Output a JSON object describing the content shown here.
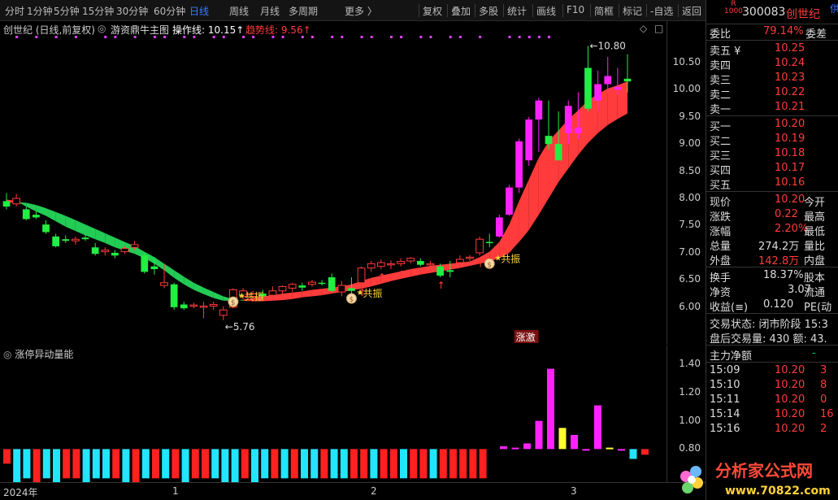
{
  "toolbar": {
    "tabs": [
      "分时",
      "1分钟",
      "5分钟",
      "15分钟",
      "30分钟",
      "60分钟",
      "日线",
      "周线",
      "月线",
      "多周期",
      "更多 〉"
    ],
    "active_tab": "日线",
    "tools": [
      "复权",
      "叠加",
      "多股",
      "统计",
      "画线",
      "F10",
      "简框",
      "标记",
      "-自选",
      "返回"
    ]
  },
  "info": {
    "stock_label": "创世纪 (日线,前复权)",
    "indicator_name": "游资鼎牛主图",
    "op_line_label": "操作线: 10.15↑",
    "trend_line_label": "趋势线: 9.56↑",
    "diamond": "◇",
    "square": "□"
  },
  "chart_annotations": {
    "high_label": "10.80",
    "low_label": "5.76",
    "gongzhen": "共振",
    "zhangji": "涨激"
  },
  "vol_panel": {
    "title": "涨停异动量能"
  },
  "date_axis": [
    "2024年",
    "1",
    "2",
    "3"
  ],
  "chart_data": [
    {
      "type": "candlestick",
      "title": "创世纪 (日线,前复权)",
      "ylim": [
        5.4,
        10.9
      ],
      "yticks": [
        6.0,
        6.5,
        7.0,
        7.5,
        8.0,
        8.5,
        9.0,
        9.5,
        10.0,
        10.5
      ],
      "candles": [
        [
          7.95,
          8.1,
          7.8,
          7.85
        ],
        [
          7.9,
          8.08,
          7.85,
          8.0
        ],
        [
          7.8,
          7.85,
          7.6,
          7.62
        ],
        [
          7.7,
          7.78,
          7.62,
          7.65
        ],
        [
          7.52,
          7.6,
          7.35,
          7.38
        ],
        [
          7.3,
          7.35,
          7.1,
          7.12
        ],
        [
          7.25,
          7.32,
          7.18,
          7.22
        ],
        [
          7.22,
          7.3,
          7.15,
          7.25
        ],
        [
          7.28,
          7.35,
          7.22,
          7.25
        ],
        [
          7.1,
          7.18,
          6.95,
          6.98
        ],
        [
          7.02,
          7.1,
          6.95,
          7.05
        ],
        [
          7.0,
          7.05,
          6.9,
          6.95
        ],
        [
          7.02,
          7.12,
          6.98,
          7.08
        ],
        [
          7.1,
          7.22,
          7.05,
          7.15
        ],
        [
          6.95,
          7.0,
          6.62,
          6.65
        ],
        [
          6.75,
          6.92,
          6.6,
          6.7
        ],
        [
          6.4,
          6.8,
          6.35,
          6.45
        ],
        [
          6.42,
          6.45,
          5.95,
          6.0
        ],
        [
          6.05,
          6.1,
          5.95,
          5.98
        ],
        [
          6.02,
          6.08,
          5.98,
          6.04
        ],
        [
          6.0,
          6.1,
          5.8,
          6.02
        ],
        [
          6.02,
          6.1,
          5.95,
          6.05
        ],
        [
          5.85,
          6.02,
          5.76,
          5.95
        ],
        [
          6.0,
          6.35,
          5.98,
          6.32
        ],
        [
          6.2,
          6.35,
          6.15,
          6.3
        ],
        [
          6.2,
          6.3,
          6.1,
          6.25
        ],
        [
          6.25,
          6.32,
          6.15,
          6.2
        ],
        [
          6.22,
          6.38,
          6.18,
          6.3
        ],
        [
          6.3,
          6.4,
          6.25,
          6.38
        ],
        [
          6.35,
          6.45,
          6.28,
          6.42
        ],
        [
          6.4,
          6.45,
          6.3,
          6.36
        ],
        [
          6.42,
          6.5,
          6.38,
          6.46
        ],
        [
          6.45,
          6.5,
          6.4,
          6.44
        ],
        [
          6.55,
          6.62,
          6.28,
          6.3
        ],
        [
          6.28,
          6.48,
          6.2,
          6.4
        ],
        [
          6.35,
          6.55,
          6.2,
          6.3
        ],
        [
          6.45,
          6.75,
          6.42,
          6.72
        ],
        [
          6.72,
          6.85,
          6.65,
          6.8
        ],
        [
          6.75,
          6.88,
          6.7,
          6.82
        ],
        [
          6.78,
          6.86,
          6.7,
          6.8
        ],
        [
          6.8,
          6.9,
          6.75,
          6.84
        ],
        [
          6.85,
          6.92,
          6.8,
          6.9
        ],
        [
          6.85,
          6.9,
          6.75,
          6.78
        ],
        [
          6.8,
          6.85,
          6.75,
          6.8
        ],
        [
          6.75,
          6.8,
          6.55,
          6.58
        ],
        [
          6.68,
          6.85,
          6.55,
          6.65
        ],
        [
          6.82,
          6.95,
          6.8,
          6.88
        ],
        [
          6.9,
          6.96,
          6.85,
          6.92
        ],
        [
          7.0,
          7.3,
          6.95,
          7.25
        ],
        [
          7.2,
          7.35,
          7.1,
          7.18
        ],
        [
          7.3,
          7.7,
          7.28,
          7.65
        ],
        [
          7.7,
          8.25,
          7.68,
          8.2
        ],
        [
          8.2,
          9.1,
          8.1,
          9.05
        ],
        [
          8.7,
          9.5,
          8.6,
          9.45
        ],
        [
          9.45,
          9.85,
          8.85,
          9.8
        ],
        [
          9.15,
          9.8,
          8.9,
          9.0
        ],
        [
          9.0,
          9.6,
          8.85,
          8.7
        ],
        [
          9.2,
          9.8,
          9.0,
          9.7
        ],
        [
          9.2,
          9.95,
          9.1,
          9.3
        ],
        [
          10.4,
          10.8,
          9.6,
          9.65
        ],
        [
          9.8,
          10.35,
          9.6,
          10.1
        ],
        [
          10.1,
          10.6,
          9.95,
          10.25
        ],
        [
          10.0,
          10.4,
          9.9,
          10.05
        ],
        [
          10.2,
          10.65,
          9.95,
          10.15
        ]
      ],
      "op_line": [
        7.98,
        7.95,
        7.85,
        7.76,
        7.68,
        7.58,
        7.48,
        7.4,
        7.32,
        7.25,
        7.18,
        7.1,
        7.04,
        6.98,
        6.9,
        6.8,
        6.68,
        6.54,
        6.42,
        6.32,
        6.24,
        6.17,
        6.12,
        6.12,
        6.14,
        6.17,
        6.2,
        6.22,
        6.25,
        6.27,
        6.29,
        6.32,
        6.34,
        6.36,
        6.38,
        6.42,
        6.48,
        6.54,
        6.58,
        6.62,
        6.66,
        6.7,
        6.73,
        6.76,
        6.78,
        6.8,
        6.82,
        6.84,
        6.92,
        7.02,
        7.2,
        7.52,
        7.95,
        8.35,
        8.75,
        9.05,
        9.25,
        9.45,
        9.62,
        9.8,
        9.92,
        10.02,
        10.08,
        10.15
      ],
      "trend_line": [
        7.92,
        7.93,
        7.92,
        7.88,
        7.82,
        7.75,
        7.68,
        7.6,
        7.52,
        7.44,
        7.36,
        7.28,
        7.2,
        7.12,
        7.02,
        6.92,
        6.8,
        6.68,
        6.56,
        6.45,
        6.36,
        6.28,
        6.2,
        6.15,
        6.12,
        6.11,
        6.11,
        6.12,
        6.13,
        6.15,
        6.18,
        6.2,
        6.22,
        6.25,
        6.28,
        6.31,
        6.34,
        6.38,
        6.43,
        6.48,
        6.52,
        6.56,
        6.6,
        6.63,
        6.66,
        6.69,
        6.72,
        6.76,
        6.8,
        6.84,
        6.9,
        7.0,
        7.2,
        7.42,
        7.7,
        8.0,
        8.3,
        8.55,
        8.8,
        9.02,
        9.2,
        9.35,
        9.46,
        9.56
      ]
    },
    {
      "type": "bar",
      "title": "涨停异动量能",
      "ylim": [
        0.6,
        1.5
      ],
      "yticks": [
        0.8,
        1.0,
        1.2,
        1.4
      ],
      "base_bars": [
        0.2,
        0.4,
        0.3,
        0.4,
        0.3,
        0.4,
        0.3,
        0.3,
        0.4,
        0.3,
        0.3,
        0.3,
        0.4,
        0.4,
        0.3,
        0.3,
        0.3,
        0.3,
        0.4,
        0.3,
        0.3,
        0.3,
        0.4,
        0.4,
        0.3,
        0.4,
        0.3,
        0.3,
        0.3,
        0.3,
        0.3,
        0.3,
        0.3,
        0.3,
        0.3,
        0.3,
        0.3,
        0.3,
        0.3,
        0.3,
        0.3,
        0.3,
        0.3,
        0.3,
        0.3,
        0.3,
        0.3,
        0.3,
        0.3
      ],
      "base_colors": [
        "red",
        "cyan",
        "cyan",
        "red",
        "cyan",
        "cyan",
        "red",
        "red",
        "cyan",
        "cyan",
        "cyan",
        "red",
        "cyan",
        "red",
        "cyan",
        "red",
        "cyan",
        "red",
        "cyan",
        "red",
        "red",
        "cyan",
        "cyan",
        "cyan",
        "red",
        "cyan",
        "cyan",
        "red",
        "cyan",
        "red",
        "cyan",
        "cyan",
        "red",
        "cyan",
        "cyan",
        "red",
        "red",
        "cyan",
        "red",
        "red",
        "cyan",
        "red",
        "red",
        "cyan",
        "red",
        "red",
        "red",
        "red",
        "red"
      ],
      "signal_bars": [
        {
          "value": 0.82,
          "color": "magenta"
        },
        {
          "value": 0.81,
          "color": "magenta"
        },
        {
          "value": 0.84,
          "color": "magenta"
        },
        {
          "value": 1.0,
          "color": "magenta"
        },
        {
          "value": 1.37,
          "color": "magenta"
        },
        {
          "value": 0.95,
          "color": "yellow"
        },
        {
          "value": 0.9,
          "color": "magenta"
        },
        {
          "value": 0.8,
          "color": "magenta"
        },
        {
          "value": 1.11,
          "color": "magenta"
        },
        {
          "value": 0.81,
          "color": "yellow"
        },
        {
          "value": 0.8,
          "color": "magenta"
        },
        {
          "value": 0.73,
          "color": "cyan"
        },
        {
          "value": 0.76,
          "color": "red"
        }
      ]
    }
  ],
  "quote": {
    "code": "300083",
    "name": "创世纪",
    "tag": "供",
    "badge_top": "R",
    "badge_bottom": "1000",
    "weibi_label": "委比",
    "weibi_value": "79.14%",
    "weicha_label": "委差",
    "asks": [
      {
        "label": "卖五",
        "yen": "¥",
        "price": "10.25"
      },
      {
        "label": "卖四",
        "yen": "",
        "price": "10.24"
      },
      {
        "label": "卖三",
        "yen": "",
        "price": "10.23"
      },
      {
        "label": "卖二",
        "yen": "",
        "price": "10.22"
      },
      {
        "label": "卖一",
        "yen": "",
        "price": "10.21"
      }
    ],
    "bids": [
      {
        "label": "买一",
        "price": "10.20"
      },
      {
        "label": "买二",
        "price": "10.19"
      },
      {
        "label": "买三",
        "price": "10.18"
      },
      {
        "label": "买四",
        "price": "10.17"
      },
      {
        "label": "买五",
        "price": "10.16"
      }
    ],
    "stats": [
      {
        "label": "现价",
        "value": "10.20",
        "color": "red",
        "label2": "今开"
      },
      {
        "label": "涨跌",
        "value": "0.22",
        "color": "red",
        "label2": "最高"
      },
      {
        "label": "涨幅",
        "value": "2.20%",
        "color": "red",
        "label2": "最低"
      },
      {
        "label": "总量",
        "value": "274.2万",
        "color": "yellow",
        "label2": "量比"
      },
      {
        "label": "外盘",
        "value": "142.8万",
        "color": "red",
        "label2": "内盘"
      }
    ],
    "stats2": [
      {
        "label": "换手",
        "value": "18.37%",
        "label2": "股本"
      },
      {
        "label": "净资",
        "value": "3.07",
        "label2": "流通"
      },
      {
        "label": "收益(≡)",
        "value": "0.120",
        "label2": "PE(动"
      }
    ],
    "trade_status": "交易状态: 闭市阶段 15:3",
    "after_hours": "盘后交易量: 430  额: 43.",
    "main_flow_label": "主力净额",
    "main_flow_value": "-",
    "ticks": [
      {
        "time": "15:09",
        "price": "10.20",
        "vol": "3"
      },
      {
        "time": "15:10",
        "price": "10.20",
        "vol": "8"
      },
      {
        "time": "15:11",
        "price": "10.20",
        "vol": "0"
      },
      {
        "time": "15:14",
        "price": "10.20",
        "vol": "16"
      },
      {
        "time": "15:16",
        "price": "10.20",
        "vol": "2"
      }
    ]
  },
  "watermark": {
    "text": "分析家公式网",
    "url": "www.70822.com"
  }
}
